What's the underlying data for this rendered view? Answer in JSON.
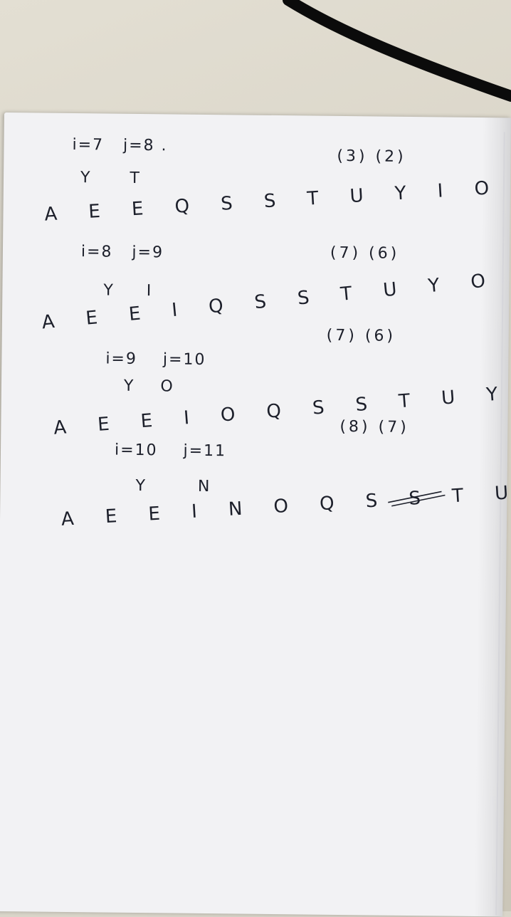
{
  "notes": {
    "block1": {
      "ij": "i=7   j=8 .",
      "counts": "(3) (2)",
      "yt": "Y      T",
      "seq": "A E E Q S S T U Y I O N"
    },
    "block2": {
      "ij": "i=8   j=9",
      "counts": "(7) (6)",
      "yt": "Y     I",
      "seq": "A E E I Q S S T U Y O N"
    },
    "block3": {
      "ij": "i=9    j=10",
      "counts": "(7) (6)",
      "yt": "Y    O",
      "seq": "A E E I O Q S S T U Y N"
    },
    "block4": {
      "ij": "i=10    j=11",
      "counts": "(8) (7)",
      "yt": "Y        N",
      "seq": "A E E I N O Q S S T U Y"
    }
  },
  "colors": {
    "ink": "#1c1f2a",
    "paper": "#f2f2f4",
    "desk": "#d9d5c9"
  }
}
